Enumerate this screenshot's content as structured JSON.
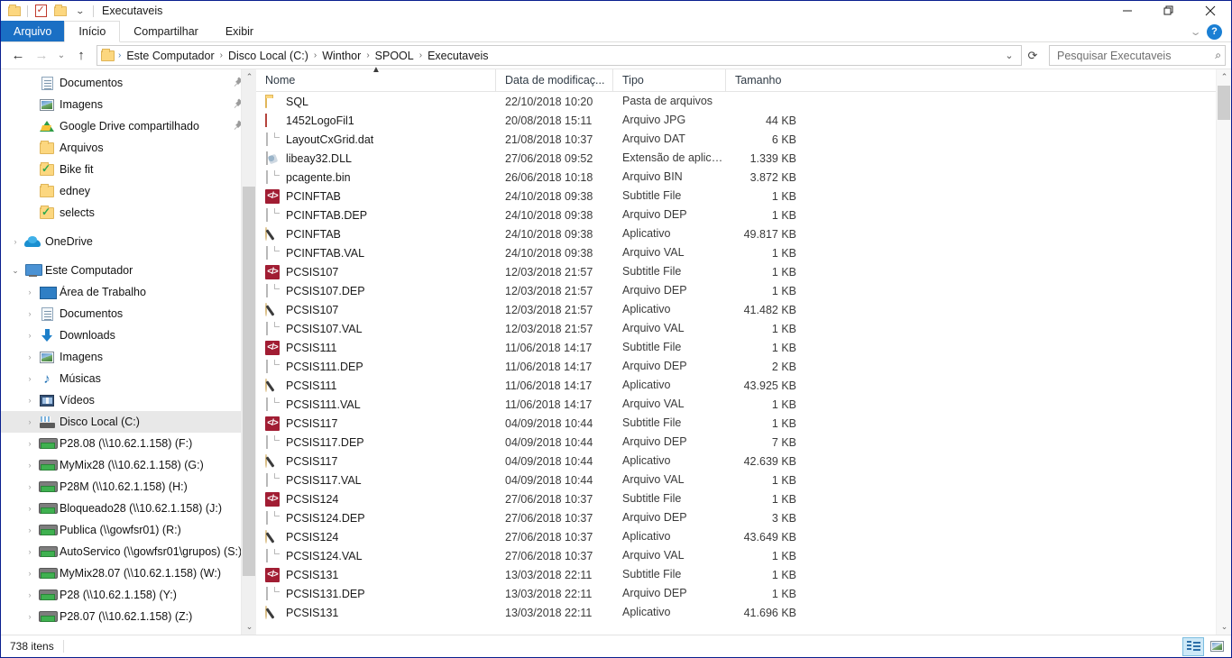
{
  "window": {
    "title": "Executaveis",
    "quick_access": [
      "folder-icon",
      "properties-icon",
      "new-folder-icon",
      "customize-dropdown-icon"
    ],
    "controls": {
      "minimize": "minimize-icon",
      "restore": "restore-icon",
      "close": "close-icon"
    },
    "ribbon_collapse": "chevron-down-icon",
    "help": "?"
  },
  "tabs": [
    {
      "label": "Arquivo",
      "kind": "file"
    },
    {
      "label": "Início",
      "kind": "active"
    },
    {
      "label": "Compartilhar",
      "kind": "normal"
    },
    {
      "label": "Exibir",
      "kind": "normal"
    }
  ],
  "address": {
    "back": "back-arrow-icon",
    "forward": "forward-arrow-icon",
    "recent": "chevron-down-icon",
    "up": "up-arrow-icon",
    "breadcrumbs": [
      "Este Computador",
      "Disco Local (C:)",
      "Winthor",
      "SPOOL",
      "Executaveis"
    ],
    "dropdown": "chevron-down-icon",
    "refresh": "refresh-icon"
  },
  "search": {
    "placeholder": "Pesquisar Executaveis",
    "value": "",
    "icon": "search-icon"
  },
  "sidebar": {
    "items": [
      {
        "label": "Documentos",
        "icon": "documents-icon",
        "indent": 2,
        "expander": "",
        "pinned": true,
        "selected": false
      },
      {
        "label": "Imagens",
        "icon": "pictures-icon",
        "indent": 2,
        "expander": "",
        "pinned": true,
        "selected": false
      },
      {
        "label": "Google Drive compartilhado",
        "icon": "google-drive-icon",
        "indent": 2,
        "expander": "",
        "pinned": true,
        "selected": false
      },
      {
        "label": "Arquivos",
        "icon": "folder-icon",
        "indent": 2,
        "expander": "",
        "pinned": false,
        "selected": false
      },
      {
        "label": "Bike fit",
        "icon": "folder-sync-icon",
        "indent": 2,
        "expander": "",
        "pinned": false,
        "selected": false
      },
      {
        "label": "edney",
        "icon": "folder-icon",
        "indent": 2,
        "expander": "",
        "pinned": false,
        "selected": false
      },
      {
        "label": "selects",
        "icon": "folder-sync-icon",
        "indent": 2,
        "expander": "",
        "pinned": false,
        "selected": false
      },
      {
        "label": "",
        "icon": "spacer",
        "indent": 1,
        "expander": "",
        "pinned": false,
        "selected": false
      },
      {
        "label": "OneDrive",
        "icon": "onedrive-icon",
        "indent": 1,
        "expander": "›",
        "pinned": false,
        "selected": false
      },
      {
        "label": "",
        "icon": "spacer",
        "indent": 1,
        "expander": "",
        "pinned": false,
        "selected": false
      },
      {
        "label": "Este Computador",
        "icon": "this-pc-icon",
        "indent": 1,
        "expander": "⌄",
        "pinned": false,
        "selected": false
      },
      {
        "label": "Área de Trabalho",
        "icon": "desktop-icon",
        "indent": 2,
        "expander": "›",
        "pinned": false,
        "selected": false
      },
      {
        "label": "Documentos",
        "icon": "documents-icon",
        "indent": 2,
        "expander": "›",
        "pinned": false,
        "selected": false
      },
      {
        "label": "Downloads",
        "icon": "downloads-icon",
        "indent": 2,
        "expander": "›",
        "pinned": false,
        "selected": false
      },
      {
        "label": "Imagens",
        "icon": "pictures-icon",
        "indent": 2,
        "expander": "›",
        "pinned": false,
        "selected": false
      },
      {
        "label": "Músicas",
        "icon": "music-icon",
        "indent": 2,
        "expander": "›",
        "pinned": false,
        "selected": false
      },
      {
        "label": "Vídeos",
        "icon": "videos-icon",
        "indent": 2,
        "expander": "›",
        "pinned": false,
        "selected": false
      },
      {
        "label": "Disco Local (C:)",
        "icon": "hard-drive-icon",
        "indent": 2,
        "expander": "›",
        "pinned": false,
        "selected": true
      },
      {
        "label": "P28.08 (\\\\10.62.1.158) (F:)",
        "icon": "network-drive-icon",
        "indent": 2,
        "expander": "›",
        "pinned": false,
        "selected": false
      },
      {
        "label": "MyMix28 (\\\\10.62.1.158) (G:)",
        "icon": "network-drive-icon",
        "indent": 2,
        "expander": "›",
        "pinned": false,
        "selected": false
      },
      {
        "label": "P28M (\\\\10.62.1.158) (H:)",
        "icon": "network-drive-icon",
        "indent": 2,
        "expander": "›",
        "pinned": false,
        "selected": false
      },
      {
        "label": "Bloqueado28 (\\\\10.62.1.158) (J:)",
        "icon": "network-drive-icon",
        "indent": 2,
        "expander": "›",
        "pinned": false,
        "selected": false
      },
      {
        "label": "Publica (\\\\gowfsr01) (R:)",
        "icon": "network-drive-icon",
        "indent": 2,
        "expander": "›",
        "pinned": false,
        "selected": false
      },
      {
        "label": "AutoServico (\\\\gowfsr01\\grupos) (S:)",
        "icon": "network-drive-icon",
        "indent": 2,
        "expander": "›",
        "pinned": false,
        "selected": false
      },
      {
        "label": "MyMix28.07 (\\\\10.62.1.158) (W:)",
        "icon": "network-drive-icon",
        "indent": 2,
        "expander": "›",
        "pinned": false,
        "selected": false
      },
      {
        "label": "P28 (\\\\10.62.1.158) (Y:)",
        "icon": "network-drive-icon",
        "indent": 2,
        "expander": "›",
        "pinned": false,
        "selected": false
      },
      {
        "label": "P28.07 (\\\\10.62.1.158) (Z:)",
        "icon": "network-drive-icon",
        "indent": 2,
        "expander": "›",
        "pinned": false,
        "selected": false
      }
    ]
  },
  "filelist": {
    "columns": [
      {
        "label": "Nome",
        "key": "name",
        "sorted": "asc"
      },
      {
        "label": "Data de modificaç...",
        "key": "date",
        "sorted": ""
      },
      {
        "label": "Tipo",
        "key": "type",
        "sorted": ""
      },
      {
        "label": "Tamanho",
        "key": "size",
        "sorted": ""
      }
    ],
    "rows": [
      {
        "name": "SQL",
        "date": "22/10/2018 10:20",
        "type": "Pasta de arquivos",
        "size": "",
        "icon": "folder-icon"
      },
      {
        "name": "1452LogoFil1",
        "date": "20/08/2018 15:11",
        "type": "Arquivo JPG",
        "size": "44 KB",
        "icon": "jpg-file-icon"
      },
      {
        "name": "LayoutCxGrid.dat",
        "date": "21/08/2018 10:37",
        "type": "Arquivo DAT",
        "size": "6 KB",
        "icon": "generic-file-icon"
      },
      {
        "name": "libeay32.DLL",
        "date": "27/06/2018 09:52",
        "type": "Extensão de aplica...",
        "size": "1.339 KB",
        "icon": "dll-file-icon"
      },
      {
        "name": "pcagente.bin",
        "date": "26/06/2018 10:18",
        "type": "Arquivo BIN",
        "size": "3.872 KB",
        "icon": "generic-file-icon"
      },
      {
        "name": "PCINFTAB",
        "date": "24/10/2018 09:38",
        "type": "Subtitle File",
        "size": "1 KB",
        "icon": "subtitle-file-icon"
      },
      {
        "name": "PCINFTAB.DEP",
        "date": "24/10/2018 09:38",
        "type": "Arquivo DEP",
        "size": "1 KB",
        "icon": "generic-file-icon"
      },
      {
        "name": "PCINFTAB",
        "date": "24/10/2018 09:38",
        "type": "Aplicativo",
        "size": "49.817 KB",
        "icon": "application-icon"
      },
      {
        "name": "PCINFTAB.VAL",
        "date": "24/10/2018 09:38",
        "type": "Arquivo VAL",
        "size": "1 KB",
        "icon": "generic-file-icon"
      },
      {
        "name": "PCSIS107",
        "date": "12/03/2018 21:57",
        "type": "Subtitle File",
        "size": "1 KB",
        "icon": "subtitle-file-icon"
      },
      {
        "name": "PCSIS107.DEP",
        "date": "12/03/2018 21:57",
        "type": "Arquivo DEP",
        "size": "1 KB",
        "icon": "generic-file-icon"
      },
      {
        "name": "PCSIS107",
        "date": "12/03/2018 21:57",
        "type": "Aplicativo",
        "size": "41.482 KB",
        "icon": "application-icon"
      },
      {
        "name": "PCSIS107.VAL",
        "date": "12/03/2018 21:57",
        "type": "Arquivo VAL",
        "size": "1 KB",
        "icon": "generic-file-icon"
      },
      {
        "name": "PCSIS111",
        "date": "11/06/2018 14:17",
        "type": "Subtitle File",
        "size": "1 KB",
        "icon": "subtitle-file-icon"
      },
      {
        "name": "PCSIS111.DEP",
        "date": "11/06/2018 14:17",
        "type": "Arquivo DEP",
        "size": "2 KB",
        "icon": "generic-file-icon"
      },
      {
        "name": "PCSIS111",
        "date": "11/06/2018 14:17",
        "type": "Aplicativo",
        "size": "43.925 KB",
        "icon": "application-icon"
      },
      {
        "name": "PCSIS111.VAL",
        "date": "11/06/2018 14:17",
        "type": "Arquivo VAL",
        "size": "1 KB",
        "icon": "generic-file-icon"
      },
      {
        "name": "PCSIS117",
        "date": "04/09/2018 10:44",
        "type": "Subtitle File",
        "size": "1 KB",
        "icon": "subtitle-file-icon"
      },
      {
        "name": "PCSIS117.DEP",
        "date": "04/09/2018 10:44",
        "type": "Arquivo DEP",
        "size": "7 KB",
        "icon": "generic-file-icon"
      },
      {
        "name": "PCSIS117",
        "date": "04/09/2018 10:44",
        "type": "Aplicativo",
        "size": "42.639 KB",
        "icon": "application-icon"
      },
      {
        "name": "PCSIS117.VAL",
        "date": "04/09/2018 10:44",
        "type": "Arquivo VAL",
        "size": "1 KB",
        "icon": "generic-file-icon"
      },
      {
        "name": "PCSIS124",
        "date": "27/06/2018 10:37",
        "type": "Subtitle File",
        "size": "1 KB",
        "icon": "subtitle-file-icon"
      },
      {
        "name": "PCSIS124.DEP",
        "date": "27/06/2018 10:37",
        "type": "Arquivo DEP",
        "size": "3 KB",
        "icon": "generic-file-icon"
      },
      {
        "name": "PCSIS124",
        "date": "27/06/2018 10:37",
        "type": "Aplicativo",
        "size": "43.649 KB",
        "icon": "application-icon"
      },
      {
        "name": "PCSIS124.VAL",
        "date": "27/06/2018 10:37",
        "type": "Arquivo VAL",
        "size": "1 KB",
        "icon": "generic-file-icon"
      },
      {
        "name": "PCSIS131",
        "date": "13/03/2018 22:11",
        "type": "Subtitle File",
        "size": "1 KB",
        "icon": "subtitle-file-icon"
      },
      {
        "name": "PCSIS131.DEP",
        "date": "13/03/2018 22:11",
        "type": "Arquivo DEP",
        "size": "1 KB",
        "icon": "generic-file-icon"
      },
      {
        "name": "PCSIS131",
        "date": "13/03/2018 22:11",
        "type": "Aplicativo",
        "size": "41.696 KB",
        "icon": "application-icon"
      }
    ]
  },
  "statusbar": {
    "item_count": "738 itens",
    "views": [
      {
        "name": "details-view-button",
        "active": true
      },
      {
        "name": "large-icons-view-button",
        "active": false
      }
    ]
  },
  "colors": {
    "accent_blue": "#1a6fc4",
    "window_border": "#0a1f8f",
    "selection": "#e8e8e8",
    "folder_yellow": "#fcd77f",
    "subtitle_red": "#a11d33"
  }
}
